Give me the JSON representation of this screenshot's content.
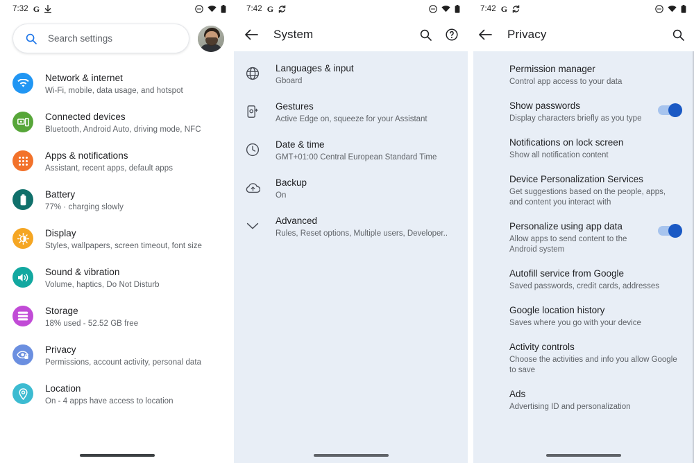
{
  "panels": [
    {
      "name": "settings-home",
      "statusbar": {
        "time": "7:32",
        "google_icon": "google-g-icon",
        "left_icon": "download-icon",
        "icons": [
          "dnd-icon",
          "wifi-icon",
          "battery-icon"
        ]
      },
      "search": {
        "placeholder": "Search settings",
        "icon": "search-icon"
      },
      "avatar": "user-avatar",
      "items": [
        {
          "title": "Network & internet",
          "subtitle": "Wi-Fi, mobile, data usage, and hotspot",
          "icon": "wifi-icon",
          "color": "#2196F3"
        },
        {
          "title": "Connected devices",
          "subtitle": "Bluetooth, Android Auto, driving mode, NFC",
          "icon": "devices-icon",
          "color": "#57A639"
        },
        {
          "title": "Apps & notifications",
          "subtitle": "Assistant, recent apps, default apps",
          "icon": "apps-grid-icon",
          "color": "#F2722B"
        },
        {
          "title": "Battery",
          "subtitle": "77% · charging slowly",
          "icon": "battery-icon",
          "color": "#10706B"
        },
        {
          "title": "Display",
          "subtitle": "Styles, wallpapers, screen timeout, font size",
          "icon": "brightness-icon",
          "color": "#F5A623"
        },
        {
          "title": "Sound & vibration",
          "subtitle": "Volume, haptics, Do Not Disturb",
          "icon": "volume-icon",
          "color": "#12A8A0"
        },
        {
          "title": "Storage",
          "subtitle": "18% used - 52.52 GB free",
          "icon": "storage-icon",
          "color": "#C14BD6"
        },
        {
          "title": "Privacy",
          "subtitle": "Permissions, account activity, personal data",
          "icon": "privacy-eye-icon",
          "color": "#6B8FE0"
        },
        {
          "title": "Location",
          "subtitle": "On - 4 apps have access to location",
          "icon": "location-pin-icon",
          "color": "#3CBBD1"
        }
      ]
    },
    {
      "name": "system-settings",
      "statusbar": {
        "time": "7:42",
        "google_icon": "google-g-icon",
        "left_icon": "sync-icon",
        "icons": [
          "dnd-icon",
          "wifi-icon",
          "battery-icon"
        ]
      },
      "appbar": {
        "back": "back-arrow-icon",
        "title": "System",
        "actions": [
          "search-icon",
          "help-icon"
        ]
      },
      "items": [
        {
          "title": "Languages & input",
          "subtitle": "Gboard",
          "icon": "globe-icon"
        },
        {
          "title": "Gestures",
          "subtitle": "Active Edge on, squeeze for your Assistant",
          "icon": "gesture-phone-icon"
        },
        {
          "title": "Date & time",
          "subtitle": "GMT+01:00 Central European Standard Time",
          "icon": "clock-icon"
        },
        {
          "title": "Backup",
          "subtitle": "On",
          "icon": "cloud-upload-icon"
        },
        {
          "title": "Advanced",
          "subtitle": "Rules, Reset options, Multiple users, Developer..",
          "icon": "chevron-down-icon"
        }
      ]
    },
    {
      "name": "privacy-settings",
      "statusbar": {
        "time": "7:42",
        "google_icon": "google-g-icon",
        "left_icon": "sync-icon",
        "icons": [
          "dnd-icon",
          "wifi-icon",
          "battery-icon"
        ]
      },
      "appbar": {
        "back": "back-arrow-icon",
        "title": "Privacy",
        "actions": [
          "search-icon"
        ]
      },
      "items": [
        {
          "title": "Permission manager",
          "subtitle": "Control app access to your data",
          "toggle": null
        },
        {
          "title": "Show passwords",
          "subtitle": "Display characters briefly as you type",
          "toggle": "on"
        },
        {
          "title": "Notifications on lock screen",
          "subtitle": "Show all notification content",
          "toggle": null
        },
        {
          "title": "Device Personalization Services",
          "subtitle": "Get suggestions based on the people, apps, and content you interact with",
          "toggle": null
        },
        {
          "title": "Personalize using app data",
          "subtitle": "Allow apps to send content to the Android system",
          "toggle": "on"
        },
        {
          "title": "Autofill service from Google",
          "subtitle": "Saved passwords, credit cards, addresses",
          "toggle": null
        },
        {
          "title": "Google location history",
          "subtitle": "Saves where you go with your device",
          "toggle": null
        },
        {
          "title": "Activity controls",
          "subtitle": "Choose the activities and info you allow Google to save",
          "toggle": null
        },
        {
          "title": "Ads",
          "subtitle": "Advertising ID and personalization",
          "toggle": null
        }
      ]
    }
  ],
  "colors": {
    "accent": "#1a73e8",
    "toggle_on": "#1a59c4",
    "panel_bg": "#e8eef6",
    "text": "#202124",
    "subtext": "#5f6368"
  }
}
